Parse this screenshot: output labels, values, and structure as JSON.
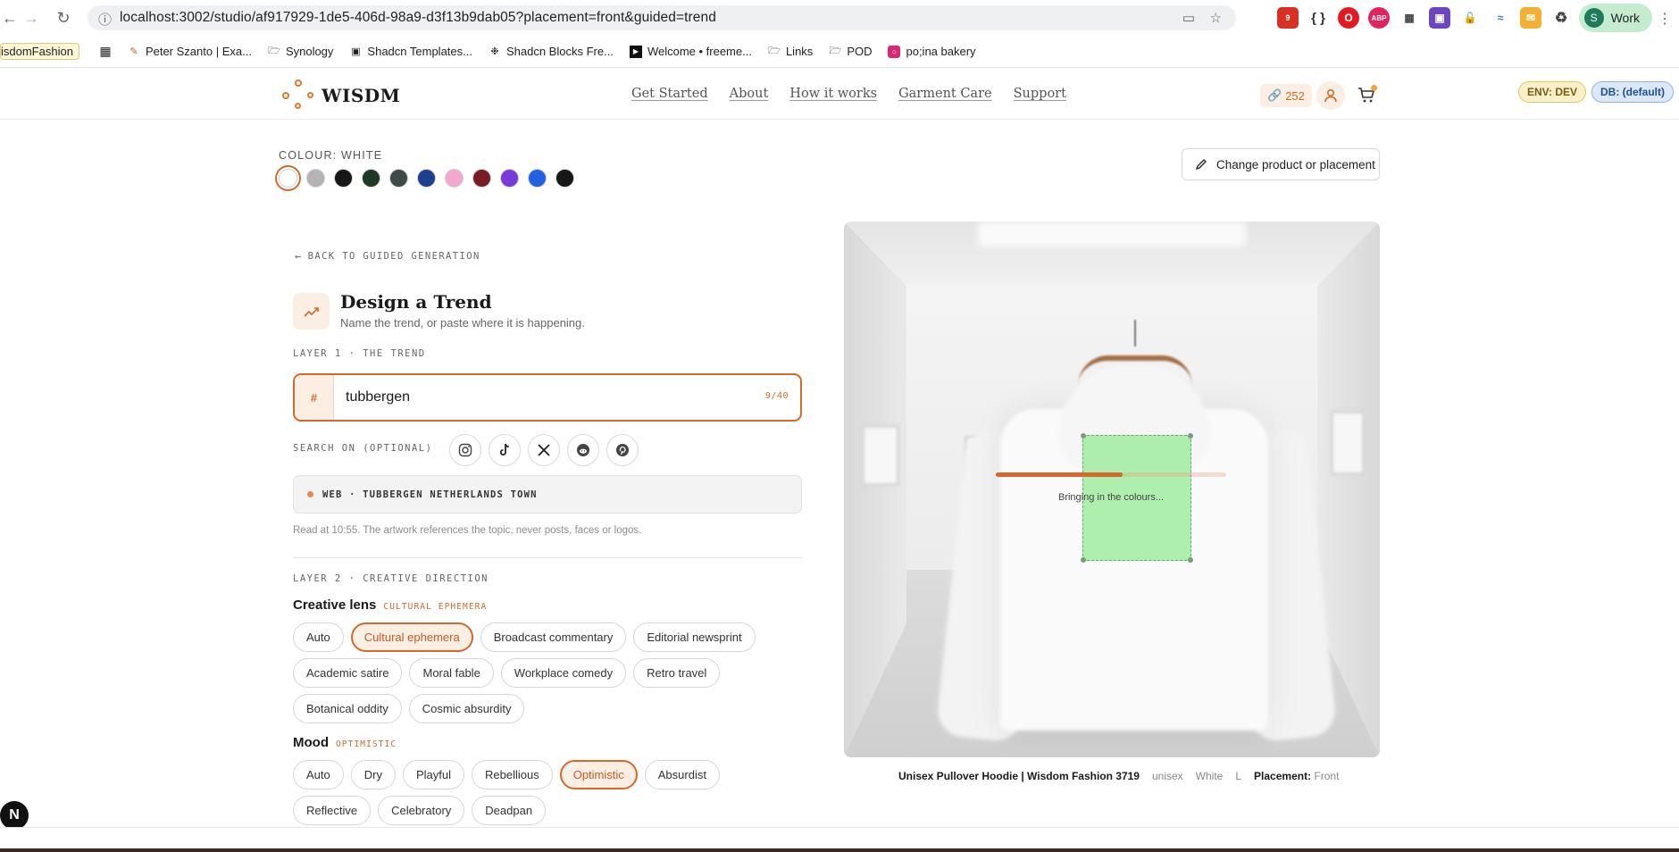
{
  "browser": {
    "url": "localhost:3002/studio/af917929-1de5-406d-98a9-d3f13b9dab05?placement=front&guided=trend",
    "profile_name": "Work",
    "profile_initial": "S",
    "extension_badge": "9"
  },
  "bookmarks": [
    "isdomFashion",
    "Peter Szanto | Exa...",
    "Synology",
    "Shadcn Templates...",
    "Shadcn Blocks Fre...",
    "Welcome • freeme...",
    "Links",
    "POD",
    "po;ina bakery"
  ],
  "header": {
    "logo": "WISDM",
    "nav": [
      "Get Started",
      "About",
      "How it works",
      "Garment Care",
      "Support"
    ],
    "credits": "252",
    "env_badge": "ENV: DEV",
    "db_badge": "DB: (default)"
  },
  "colour": {
    "label": "COLOUR: WHITE",
    "swatches": [
      "#ffffff",
      "#b4b4b4",
      "#161616",
      "#1e3a26",
      "#3e4a48",
      "#1c3f8f",
      "#f3a8cf",
      "#7a1c22",
      "#7a3ad8",
      "#2062e0",
      "#181818"
    ],
    "selected_index": 0
  },
  "change_button": "Change product or placement",
  "panel": {
    "back_link": "BACK TO GUIDED GENERATION",
    "title": "Design a Trend",
    "subtitle": "Name the trend, or paste where it is happening.",
    "layer1_label": "LAYER 1 · THE TREND",
    "trend_value": "tubbergen",
    "trend_count": "9/40",
    "search_label": "SEARCH ON (OPTIONAL)",
    "socials": [
      "instagram-icon",
      "tiktok-icon",
      "x-icon",
      "reddit-icon",
      "pinterest-icon"
    ],
    "source": "WEB · TUBBERGEN NETHERLANDS TOWN",
    "read_note": "Read at 10:55. The artwork references the topic, never posts, faces or logos.",
    "layer2_label": "LAYER 2 · CREATIVE DIRECTION",
    "lens_title": "Creative lens",
    "lens_selected": "CULTURAL EPHEMERA",
    "lens_options": [
      "Auto",
      "Cultural ephemera",
      "Broadcast commentary",
      "Editorial newsprint",
      "Academic satire",
      "Moral fable",
      "Workplace comedy",
      "Retro travel",
      "Botanical oddity",
      "Cosmic absurdity"
    ],
    "lens_active": "Cultural ephemera",
    "mood_title": "Mood",
    "mood_selected": "OPTIMISTIC",
    "mood_options": [
      "Auto",
      "Dry",
      "Playful",
      "Rebellious",
      "Optimistic",
      "Absurdist",
      "Reflective",
      "Celebratory",
      "Deadpan"
    ],
    "mood_active": "Optimistic"
  },
  "preview": {
    "progress_fraction": 0.55,
    "progress_text": "Bringing in the colours...",
    "caption_product": "Unisex Pullover Hoodie | Wisdom Fashion 3719",
    "caption_fit": "unisex",
    "caption_colour": "White",
    "caption_size": "L",
    "caption_placement_label": "Placement:",
    "caption_placement": "Front"
  },
  "colors": {
    "accent": "#d3692a",
    "accent_soft": "#fbeee3"
  }
}
